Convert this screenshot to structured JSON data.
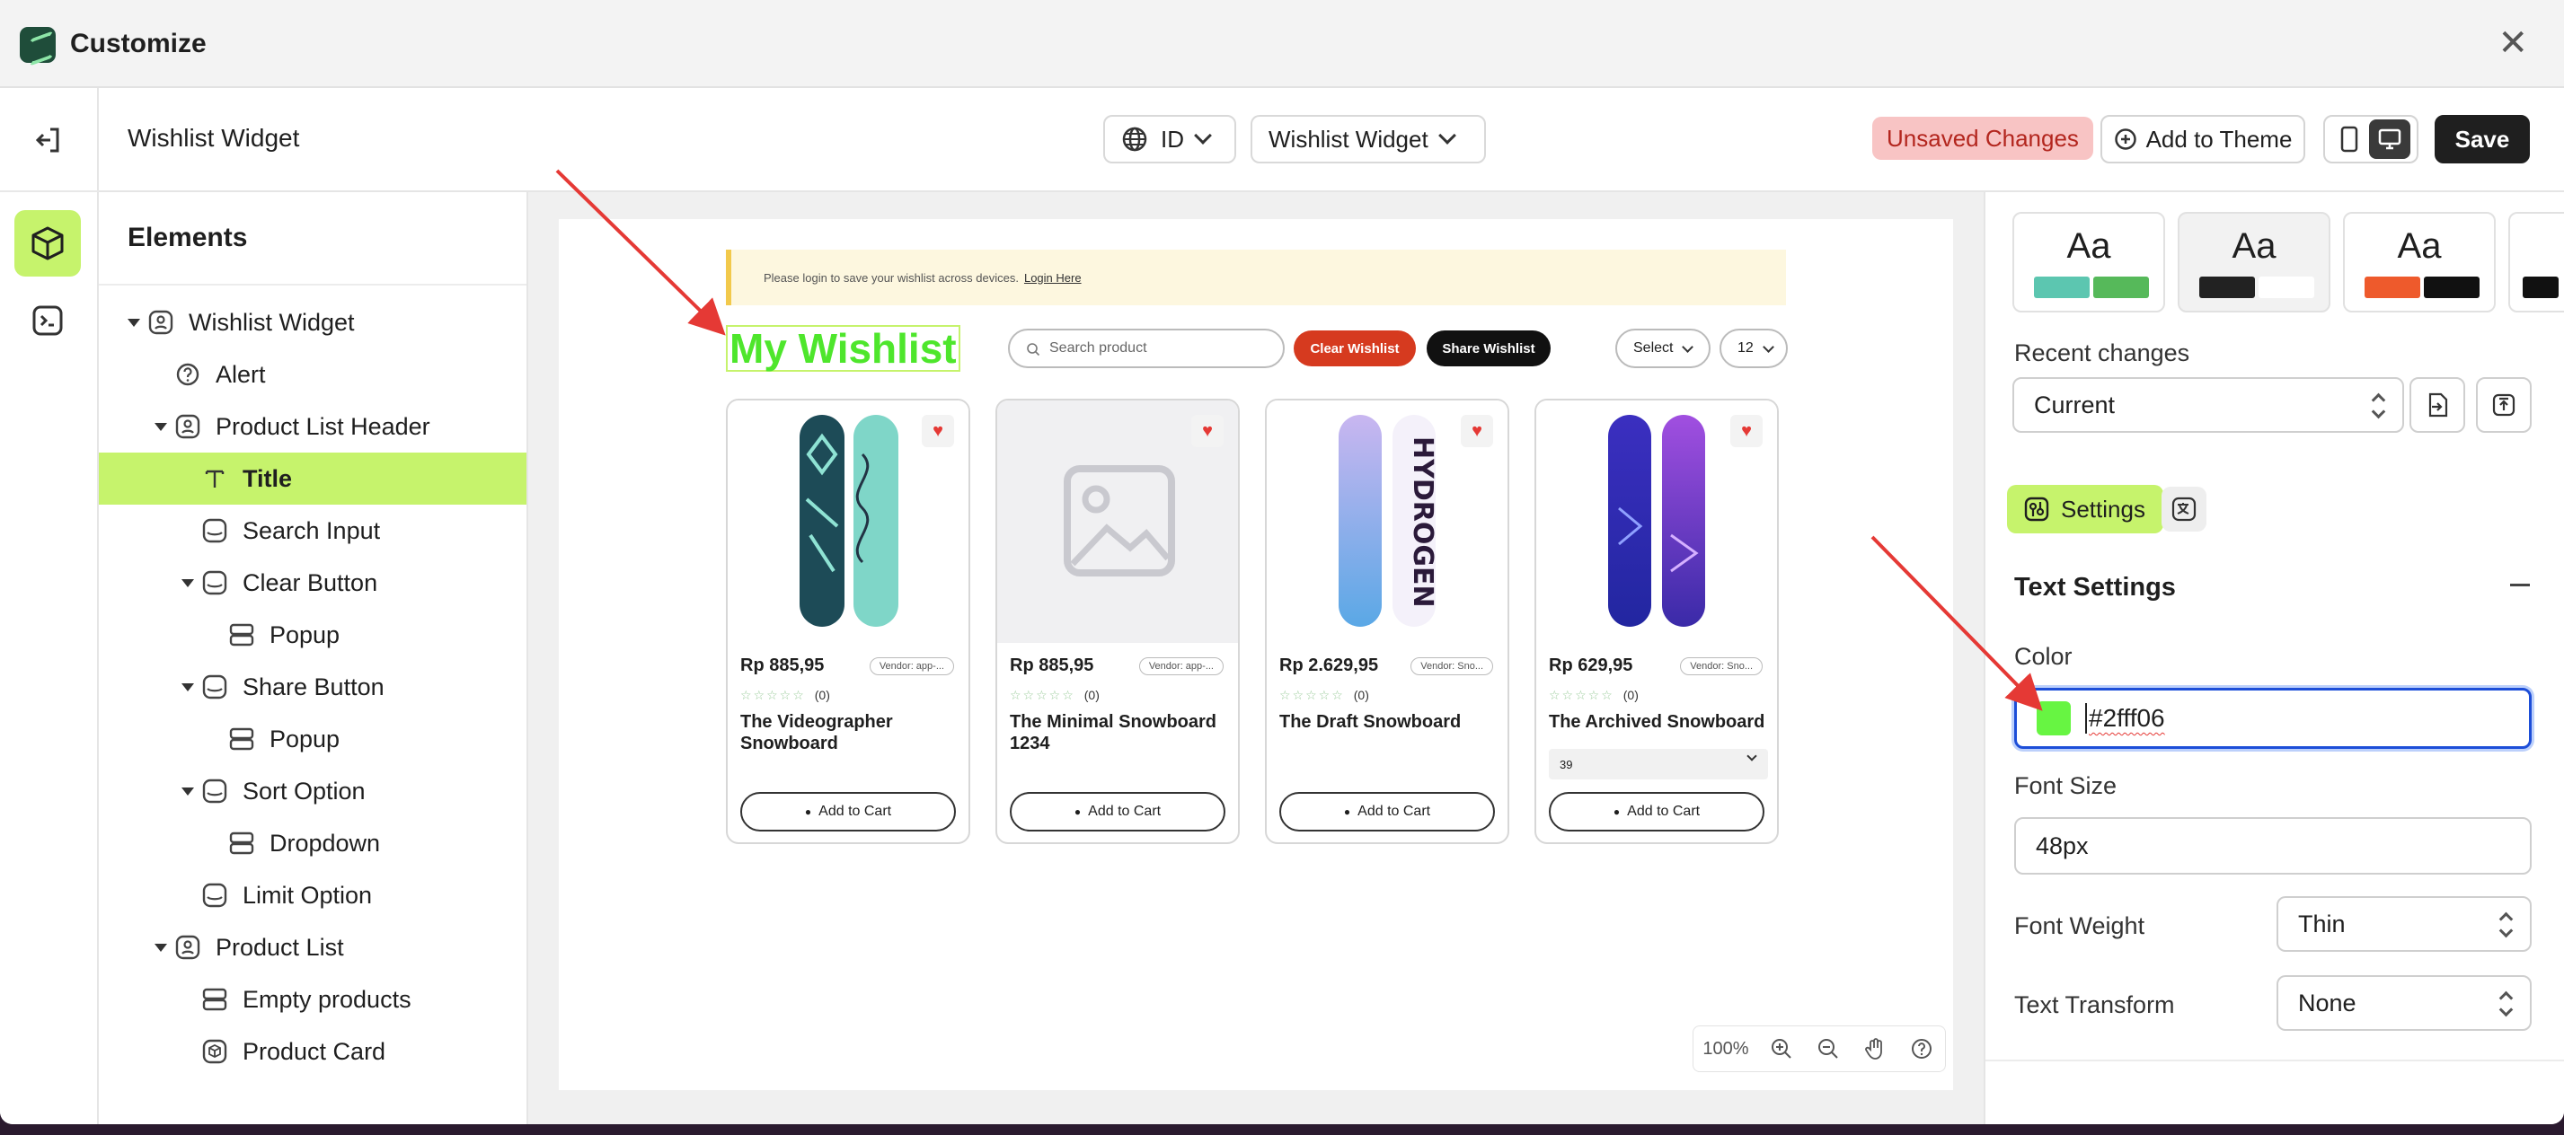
{
  "titlebar": {
    "title": "Customize"
  },
  "header": {
    "widget_name": "Wishlist Widget",
    "language": "ID",
    "widget_select": "Wishlist Widget",
    "unsaved": "Unsaved Changes",
    "add_to_theme": "Add to Theme",
    "save": "Save"
  },
  "elements": {
    "title": "Elements",
    "tree": [
      {
        "label": "Wishlist Widget",
        "level": 0,
        "caret": true,
        "icon": "widget-icon"
      },
      {
        "label": "Alert",
        "level": 1,
        "caret": false,
        "icon": "help-circle-icon"
      },
      {
        "label": "Product List Header",
        "level": 1,
        "caret": true,
        "icon": "widget-icon"
      },
      {
        "label": "Title",
        "level": 2,
        "caret": false,
        "icon": "text-icon",
        "selected": true
      },
      {
        "label": "Search Input",
        "level": 2,
        "caret": false,
        "icon": "input-box-icon"
      },
      {
        "label": "Clear Button",
        "level": 2,
        "caret": true,
        "icon": "input-box-icon"
      },
      {
        "label": "Popup",
        "level": 3,
        "caret": false,
        "icon": "layout-rows-icon"
      },
      {
        "label": "Share Button",
        "level": 2,
        "caret": true,
        "icon": "input-box-icon"
      },
      {
        "label": "Popup",
        "level": 3,
        "caret": false,
        "icon": "layout-rows-icon"
      },
      {
        "label": "Sort Option",
        "level": 2,
        "caret": true,
        "icon": "input-box-icon"
      },
      {
        "label": "Dropdown",
        "level": 3,
        "caret": false,
        "icon": "layout-rows-icon"
      },
      {
        "label": "Limit Option",
        "level": 2,
        "caret": false,
        "icon": "input-box-icon"
      },
      {
        "label": "Product List",
        "level": 1,
        "caret": true,
        "icon": "widget-icon"
      },
      {
        "label": "Empty products",
        "level": 2,
        "caret": false,
        "icon": "layout-rows-icon"
      },
      {
        "label": "Product Card",
        "level": 2,
        "caret": false,
        "icon": "cube-outline-icon"
      }
    ]
  },
  "preview": {
    "alert_text": "Please login to save your wishlist across devices.",
    "alert_link": "Login Here",
    "title": "My Wishlist",
    "search_placeholder": "Search product",
    "clear_label": "Clear Wishlist",
    "share_label": "Share Wishlist",
    "sort_label": "Select",
    "limit_label": "12",
    "clear_color": "#d63a1f",
    "share_color": "#111111",
    "products": [
      {
        "price": "Rp 885,95",
        "vendor": "Vendor: app-...",
        "reviews": "(0)",
        "name": "The Videographer Snowboard",
        "variant": "",
        "button": "Add to Cart",
        "image": "snowboard-teal"
      },
      {
        "price": "Rp 885,95",
        "vendor": "Vendor: app-...",
        "reviews": "(0)",
        "name": "The Minimal Snowboard 1234",
        "variant": "",
        "button": "Add to Cart",
        "image": "placeholder"
      },
      {
        "price": "Rp 2.629,95",
        "vendor": "Vendor: Sno...",
        "reviews": "(0)",
        "name": "The Draft Snowboard",
        "variant": "",
        "button": "Add to Cart",
        "image": "snowboard-hydrogen"
      },
      {
        "price": "Rp 629,95",
        "vendor": "Vendor: Sno...",
        "reviews": "(0)",
        "name": "The Archived Snowboard",
        "variant": "39",
        "button": "Add to Cart",
        "image": "snowboard-purple"
      }
    ],
    "zoom": "100%"
  },
  "right": {
    "themes": [
      {
        "label": "Aa",
        "c1": "#5cc6b0",
        "c2": "#56b95a"
      },
      {
        "label": "Aa",
        "c1": "#222222",
        "c2": "#ffffff"
      },
      {
        "label": "Aa",
        "c1": "#ee5a2c",
        "c2": "#111111"
      }
    ],
    "recent_label": "Recent changes",
    "recent_value": "Current",
    "tab_settings": "Settings",
    "section_title": "Text Settings",
    "color_label": "Color",
    "color_value": "#2fff06",
    "font_size_label": "Font Size",
    "font_size_value": "48px",
    "font_weight_label": "Font Weight",
    "font_weight_value": "Thin",
    "text_transform_label": "Text Transform",
    "text_transform_value": "None"
  },
  "colors": {
    "accent": "#c6f36c",
    "annotation": "#e53935",
    "focus": "#1d4ed8"
  }
}
